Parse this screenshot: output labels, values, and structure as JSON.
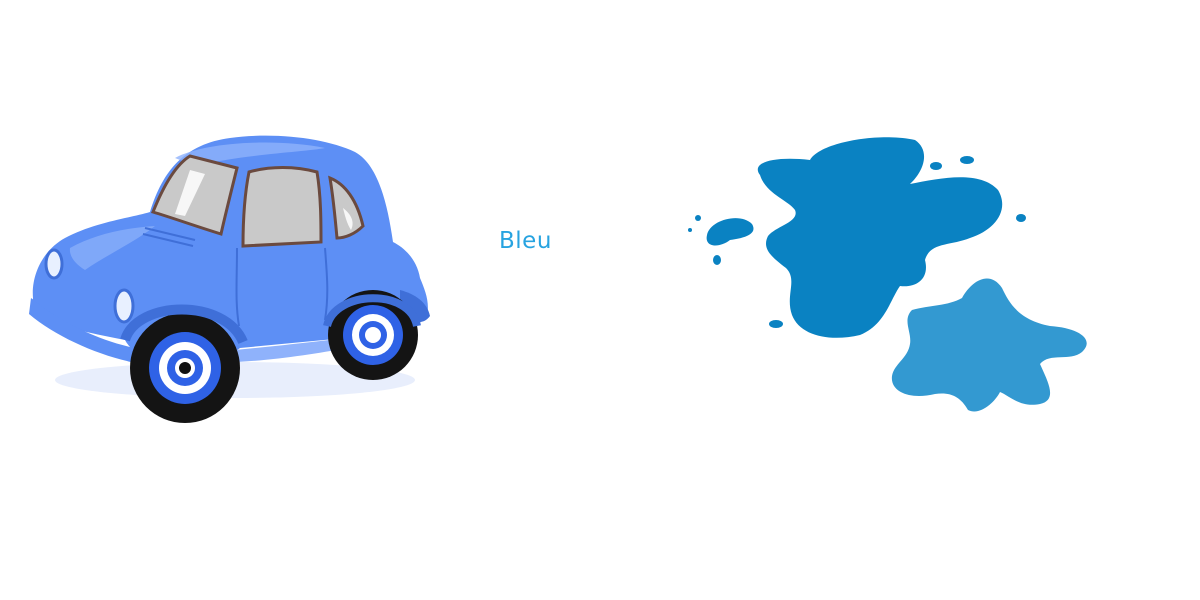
{
  "word": {
    "label": "Bleu"
  },
  "colors": {
    "label_text": "#27a3e0",
    "car_body": "#5d8ff5",
    "car_highlight": "#8fb2fb",
    "car_shadow": "#3f6fd8",
    "window_glass": "#c9c9c9",
    "window_frame": "#6b4a3f",
    "tire": "#141414",
    "rim_blue": "#2f62e6",
    "splash_dark": "#0a82c2",
    "splash_light": "#3399d1"
  },
  "icons": {
    "car": "blue-cartoon-car-icon",
    "splash": "blue-paint-splash-icon"
  }
}
